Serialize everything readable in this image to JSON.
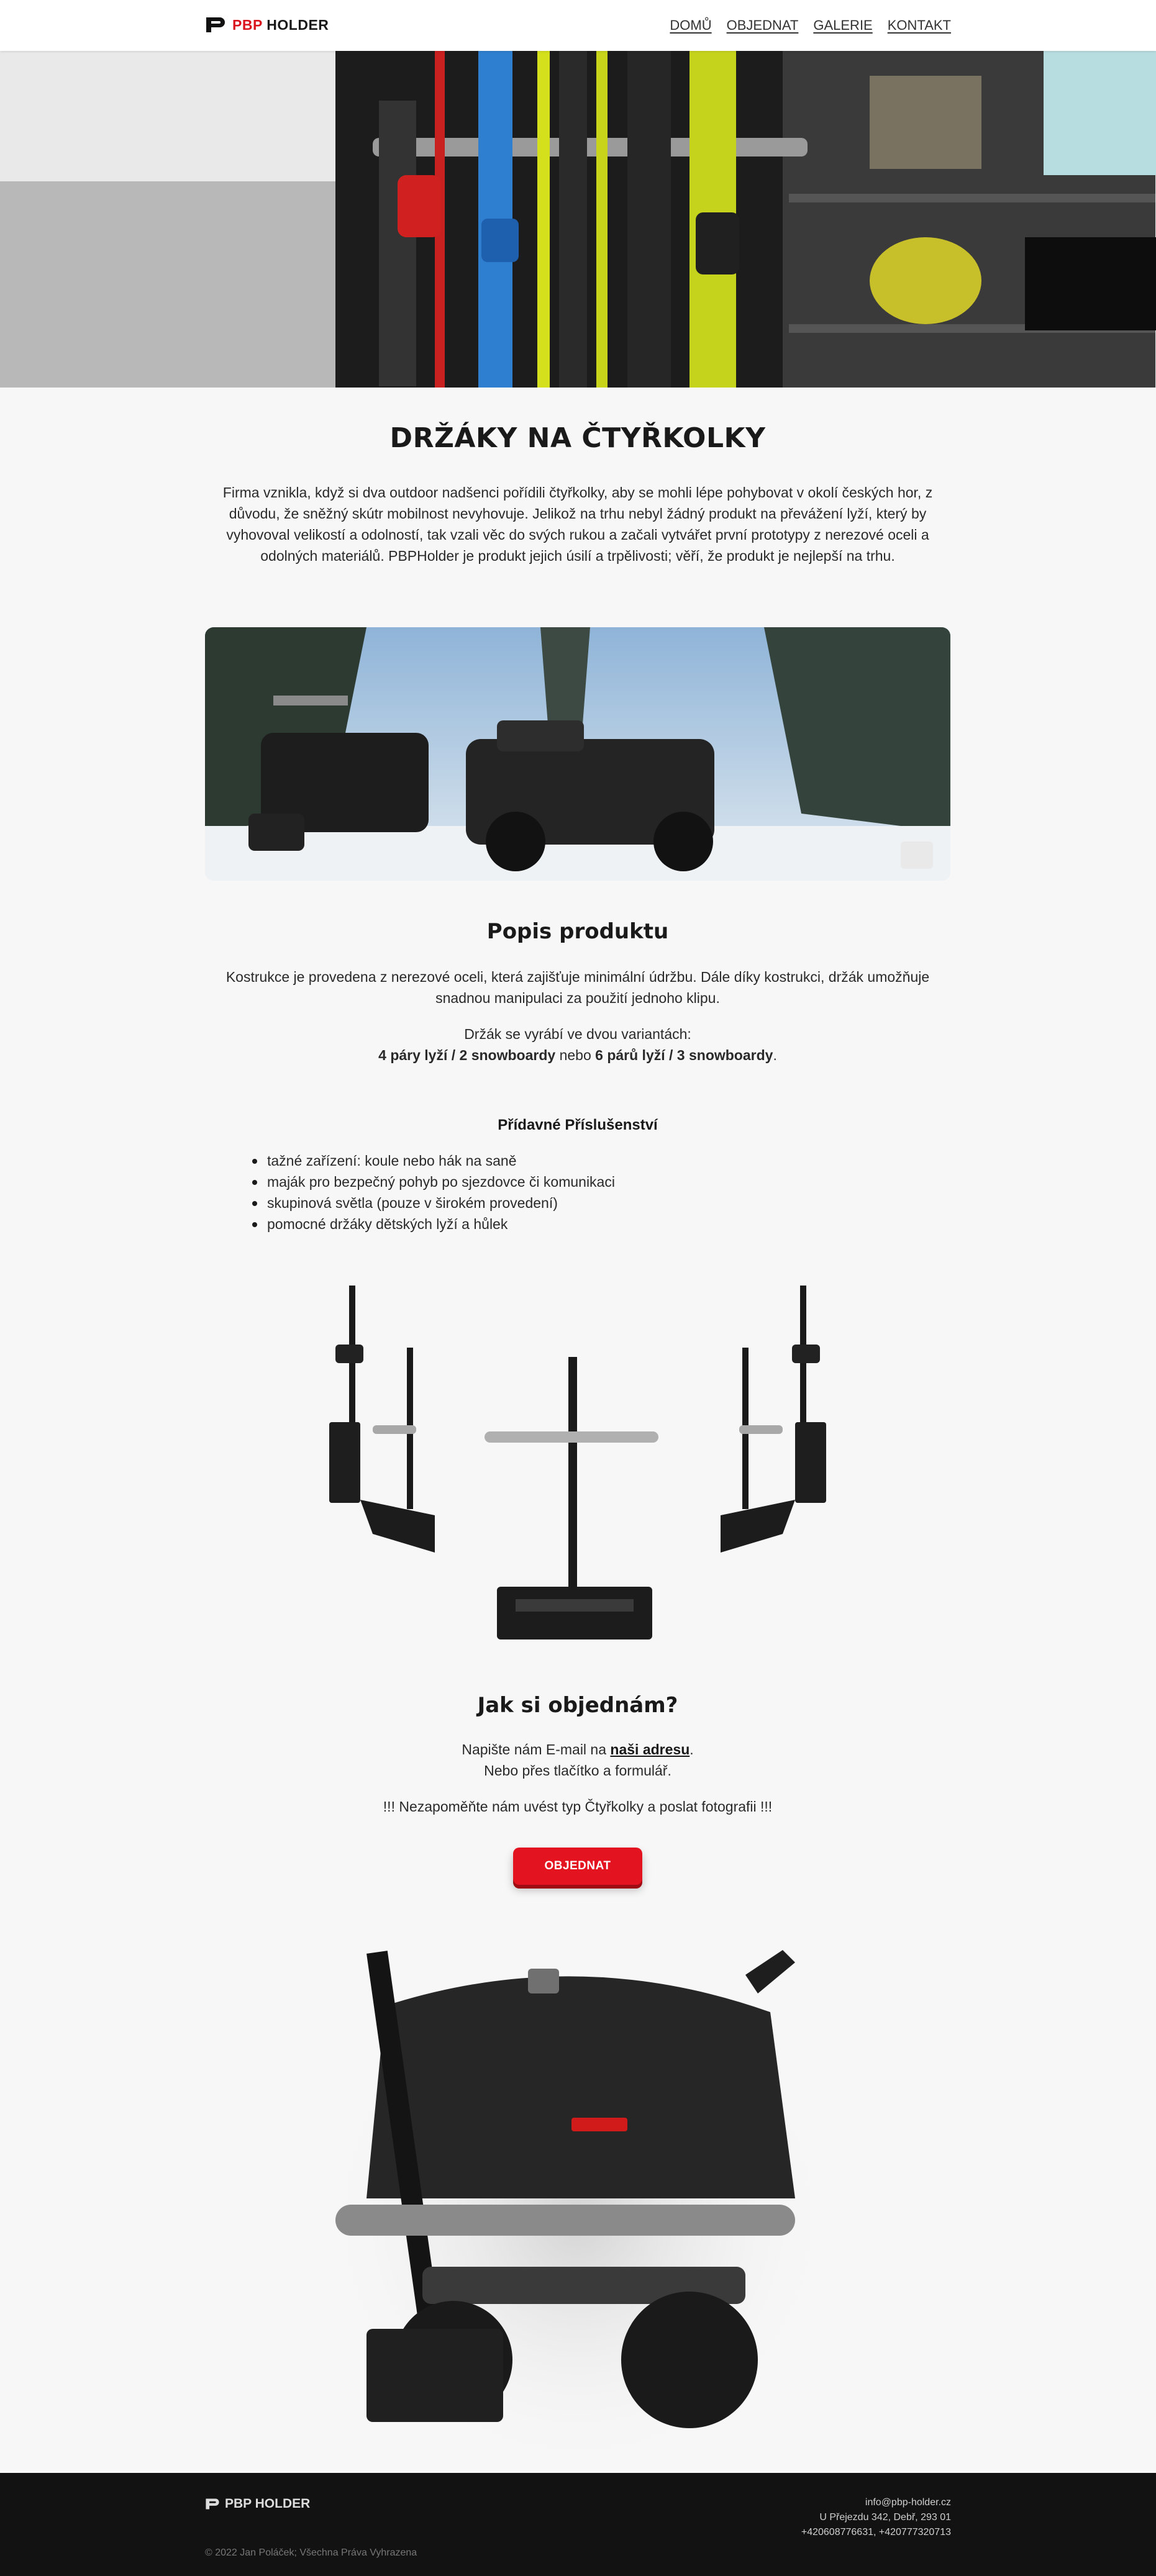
{
  "header": {
    "logo_prefix": "PBP",
    "logo_suffix": "HOLDER",
    "nav": [
      {
        "label": "DOMŮ"
      },
      {
        "label": "OBJEDNAT"
      },
      {
        "label": "GALERIE"
      },
      {
        "label": "KONTAKT"
      }
    ]
  },
  "main": {
    "title": "DRŽÁKY NA ČTYŘKOLKY",
    "intro": "Firma vznikla, když si dva outdoor nadšenci pořídili čtyřkolky, aby se mohli lépe pohybovat v okolí českých hor, z důvodu, že sněžný skútr mobilnost nevyhovuje. Jelikož na trhu nebyl žádný produkt na převážení lyží, který by vyhovoval velikostí a odolností, tak vzali věc do svých rukou a začali vytvářet první prototypy z nerezové oceli a odolných materiálů. PBPHolder je produkt jejich úsilí a trpělivosti; věří, že produkt je nejlepší na trhu.",
    "description": {
      "heading": "Popis produktu",
      "text": "Kostrukce je provedena z nerezové oceli, která zajišťuje minimální údržbu. Dále díky kostrukci, držák umožňuje snadnou manipulaci za použití jednoho klipu.",
      "variants_intro": "Držák se vyrábí ve dvou variantách:",
      "variant_a": "4 páry lyží / 2 snowboardy",
      "variant_joiner": " nebo ",
      "variant_b": "6 párů lyží / 3 snowboardy",
      "variant_end": "."
    },
    "accessories": {
      "heading": "Přídavné Příslušenství",
      "items": [
        "tažné zařízení: koule nebo hák na saně",
        "maják pro bezpečný pohyb po sjezdovce či komunikaci",
        "skupinová světla (pouze v širokém provedení)",
        "pomocné držáky dětských lyží a hůlek"
      ]
    },
    "order": {
      "heading": "Jak si objednám?",
      "line1_prefix": "Napište nám E-mail na ",
      "line1_link": "naši adresu",
      "line1_suffix": ".",
      "line2": "Nebo přes tlačítko a formulář.",
      "note": "!!! Nezapoměňte nám uvést typ Čtyřkolky a poslat fotografii !!!",
      "button": "OBJEDNAT"
    }
  },
  "footer": {
    "logo": "PBP HOLDER",
    "copyright": "© 2022 Jan Poláček; Všechna Práva Vyhrazena",
    "email": "info@pbp-holder.cz",
    "address": "U Přejezdu 342, Debř, 293 01",
    "phones": "+420608776631, +420777320713"
  },
  "colors": {
    "accent": "#e3141f",
    "page_bg": "#f7f7f7",
    "footer_bg": "#121212"
  }
}
